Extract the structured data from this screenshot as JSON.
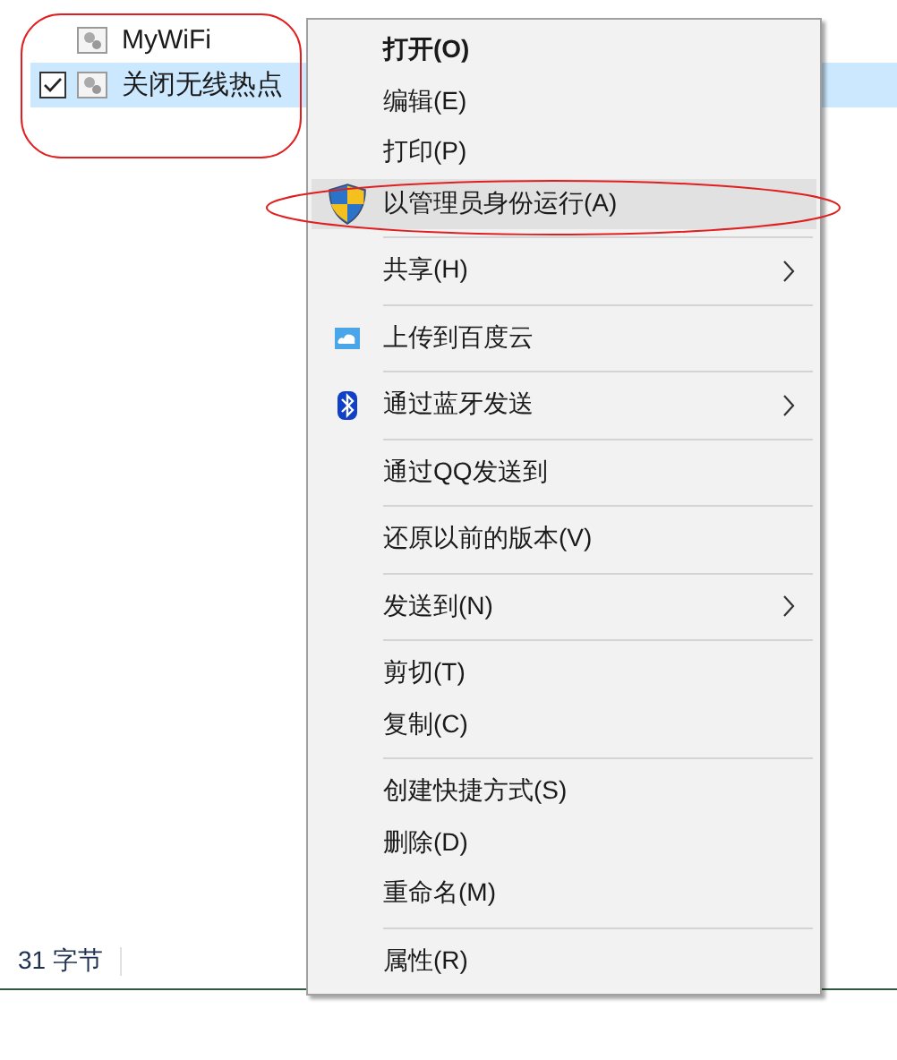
{
  "files": {
    "rows": [
      {
        "name": "MyWiFi",
        "selected": false,
        "checked": false
      },
      {
        "name": "关闭无线热点",
        "selected": true,
        "checked": true
      }
    ]
  },
  "context_menu": {
    "items": [
      {
        "kind": "plain",
        "label": "打开(O)",
        "bold": true,
        "highlighted": false,
        "submenu": false
      },
      {
        "kind": "plain",
        "label": "编辑(E)",
        "bold": false,
        "highlighted": false,
        "submenu": false
      },
      {
        "kind": "plain",
        "label": "打印(P)",
        "bold": false,
        "highlighted": false,
        "submenu": false
      },
      {
        "kind": "shield",
        "label": "以管理员身份运行(A)",
        "bold": false,
        "highlighted": true,
        "submenu": false
      },
      {
        "kind": "separator"
      },
      {
        "kind": "plain",
        "label": "共享(H)",
        "bold": false,
        "highlighted": false,
        "submenu": true
      },
      {
        "kind": "separator"
      },
      {
        "kind": "cloud",
        "label": "上传到百度云",
        "bold": false,
        "highlighted": false,
        "submenu": false
      },
      {
        "kind": "separator"
      },
      {
        "kind": "bluetooth",
        "label": "通过蓝牙发送",
        "bold": false,
        "highlighted": false,
        "submenu": true
      },
      {
        "kind": "separator"
      },
      {
        "kind": "plain",
        "label": "通过QQ发送到",
        "bold": false,
        "highlighted": false,
        "submenu": false
      },
      {
        "kind": "separator"
      },
      {
        "kind": "plain",
        "label": "还原以前的版本(V)",
        "bold": false,
        "highlighted": false,
        "submenu": false
      },
      {
        "kind": "separator"
      },
      {
        "kind": "plain",
        "label": "发送到(N)",
        "bold": false,
        "highlighted": false,
        "submenu": true
      },
      {
        "kind": "separator"
      },
      {
        "kind": "plain",
        "label": "剪切(T)",
        "bold": false,
        "highlighted": false,
        "submenu": false
      },
      {
        "kind": "plain",
        "label": "复制(C)",
        "bold": false,
        "highlighted": false,
        "submenu": false
      },
      {
        "kind": "separator"
      },
      {
        "kind": "plain",
        "label": "创建快捷方式(S)",
        "bold": false,
        "highlighted": false,
        "submenu": false
      },
      {
        "kind": "plain",
        "label": "删除(D)",
        "bold": false,
        "highlighted": false,
        "submenu": false
      },
      {
        "kind": "plain",
        "label": "重命名(M)",
        "bold": false,
        "highlighted": false,
        "submenu": false
      },
      {
        "kind": "separator"
      },
      {
        "kind": "plain",
        "label": "属性(R)",
        "bold": false,
        "highlighted": false,
        "submenu": false
      }
    ]
  },
  "status_bar": {
    "text": "31 字节"
  }
}
